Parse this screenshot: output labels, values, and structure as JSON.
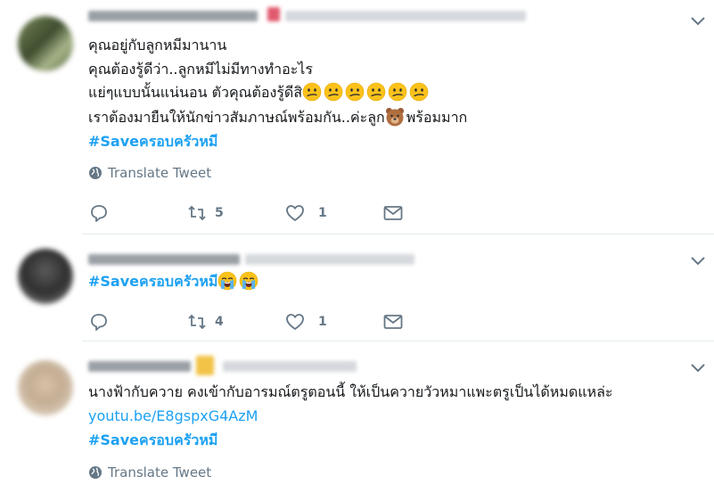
{
  "tweets": [
    {
      "lines": [
        "คุณอยู่กับลูกหมีมานาน",
        "คุณต้องรู้ดีว่า..ลูกหมีไม่มีทางทำอะไร",
        "แย่ๆแบบนั้นแน่นอน ตัวคุณต้องรู้ดีสิ",
        "เราต้องมายืนให้นักข่าวสัมภาษณ์พร้อมกัน..ค่ะลูก",
        "พร้อมมาก"
      ],
      "hashtag": "#Saveครอบครัวหมี",
      "translate": "Translate Tweet",
      "retweets": "5",
      "likes": "1"
    },
    {
      "hashtag": "#Saveครอบครัวหมี",
      "retweets": "4",
      "likes": "1"
    },
    {
      "lines": [
        "นางฟ้ากับควาย คงเข้ากับอารมณ์ตรูตอนนี้  ให้เป็นควายวัวหมาแพะตรูเป็นได้หมดแหล่ะ"
      ],
      "link": "youtu.be/E8gspxG4AzM",
      "hashtag": "#Saveครอบครัวหมี",
      "translate": "Translate Tweet"
    }
  ],
  "colors": {
    "accent": "#1da1f2",
    "muted": "#657786",
    "divider": "#e6ecf0"
  },
  "icons": [
    "chevron-down-icon",
    "globe-icon",
    "reply-icon",
    "retweet-icon",
    "like-icon",
    "message-icon",
    "confused-emoji",
    "bear-emoji",
    "crying-emoji"
  ]
}
